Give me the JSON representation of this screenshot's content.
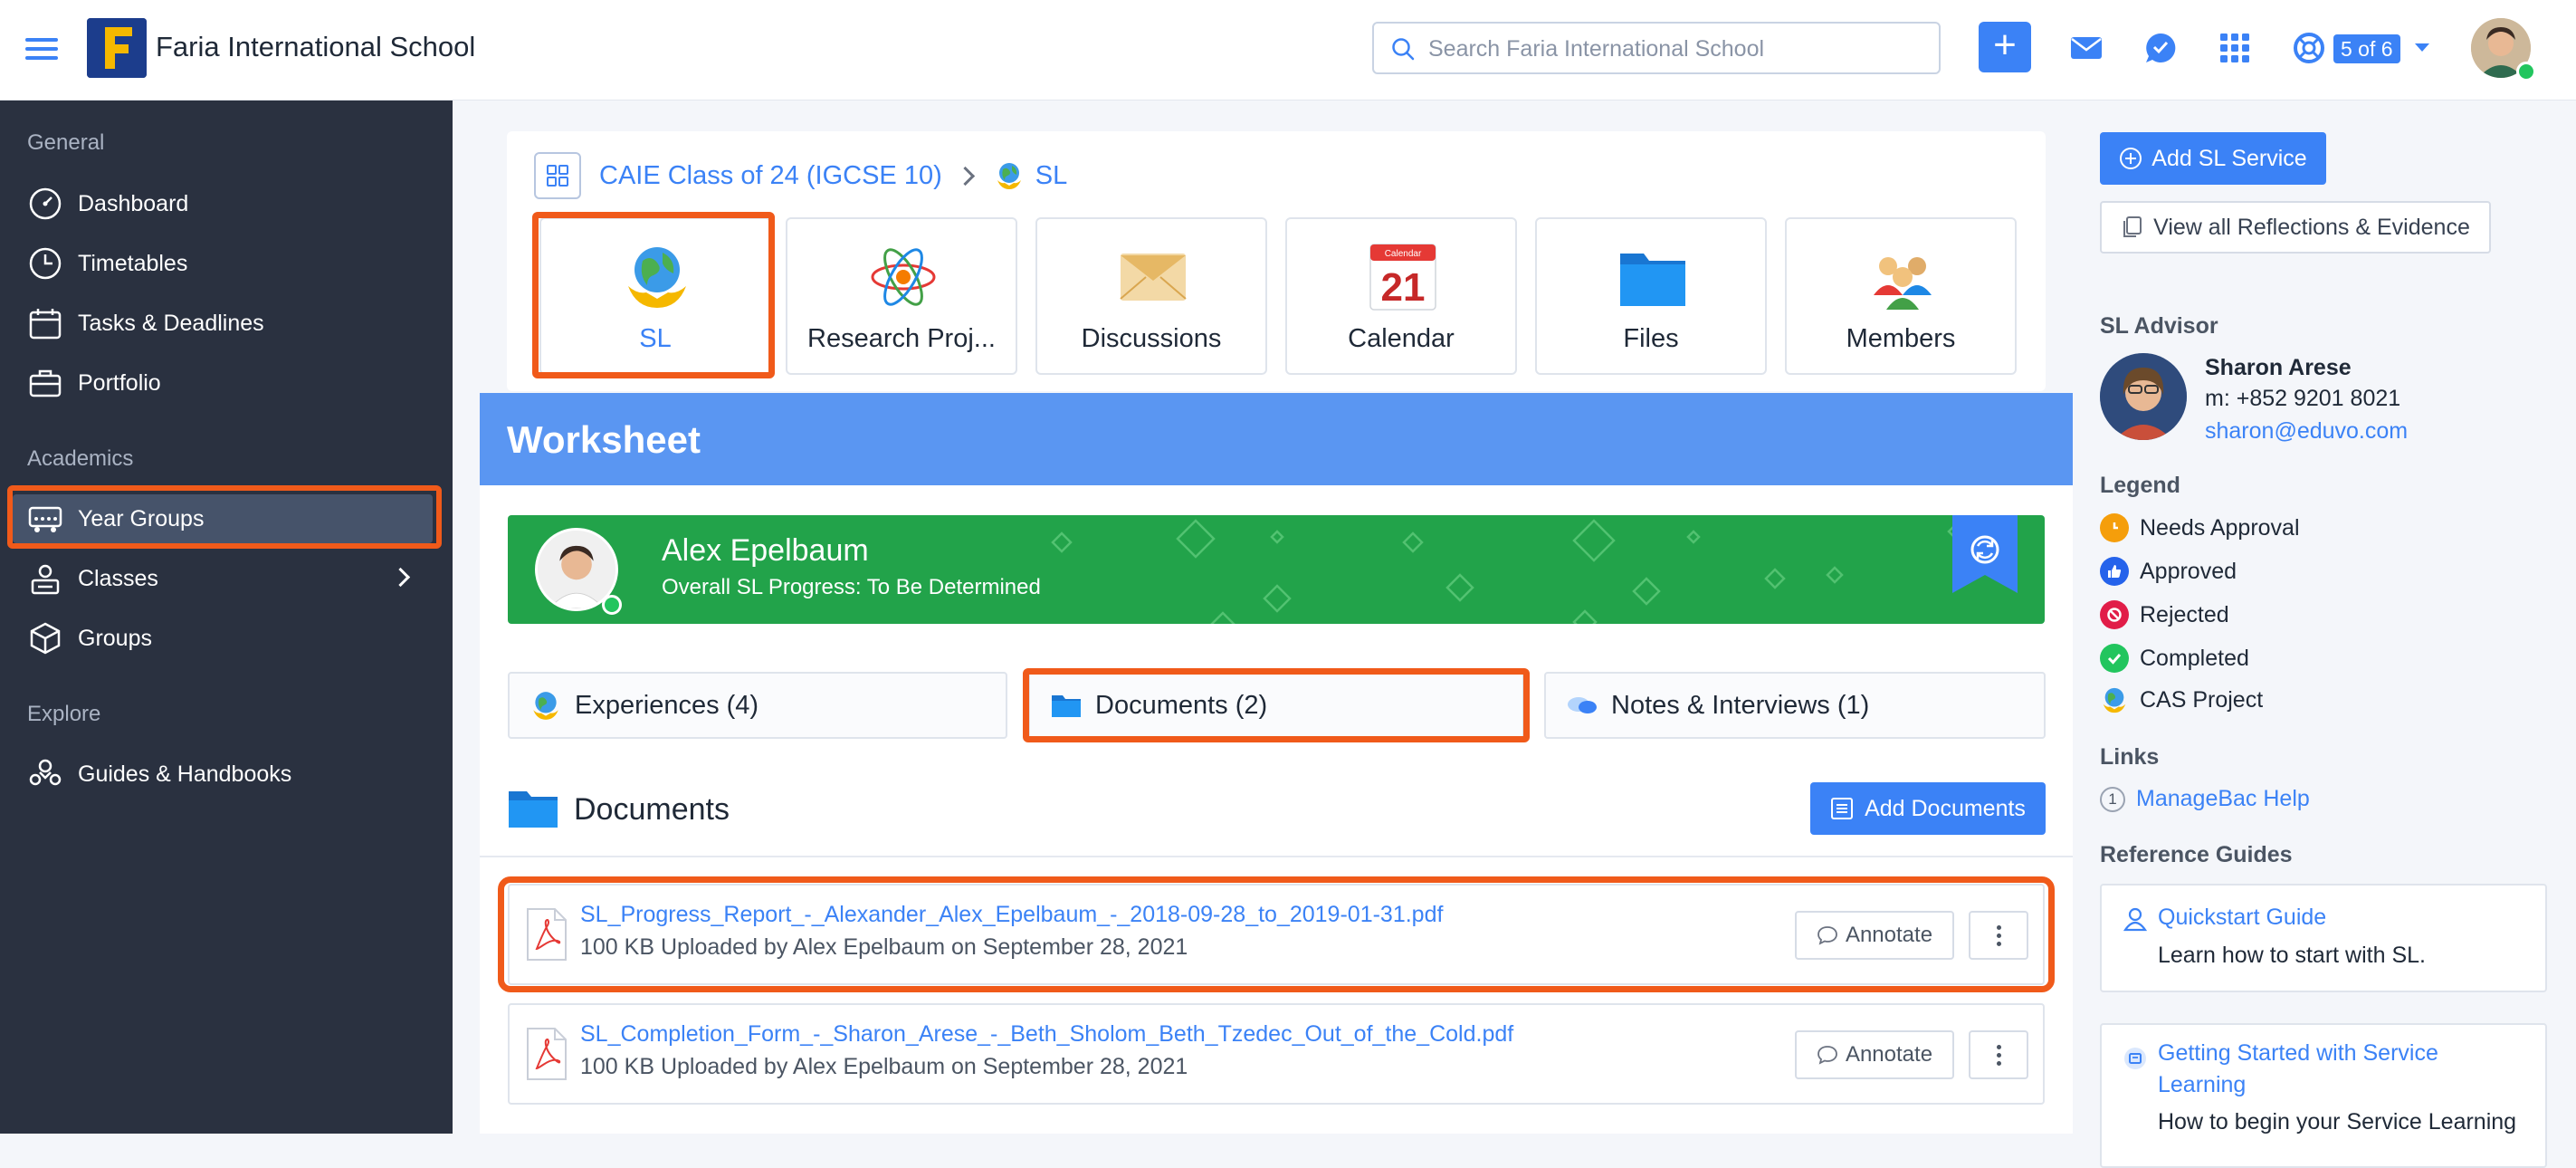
{
  "header": {
    "school_name": "Faria International School",
    "search_placeholder": "Search Faria International School",
    "plus_label": "+",
    "switcher_badge": "5 of 6"
  },
  "sidebar": {
    "sections": [
      {
        "title": "General"
      },
      {
        "title": "Academics"
      },
      {
        "title": "Explore"
      }
    ],
    "items": [
      {
        "label": "Dashboard",
        "icon": "dashboard-icon"
      },
      {
        "label": "Timetables",
        "icon": "clock-icon"
      },
      {
        "label": "Tasks & Deadlines",
        "icon": "calendar-icon"
      },
      {
        "label": "Portfolio",
        "icon": "briefcase-icon"
      },
      {
        "label": "Year Groups",
        "icon": "bus-icon"
      },
      {
        "label": "Classes",
        "icon": "classes-icon"
      },
      {
        "label": "Groups",
        "icon": "cube-icon"
      },
      {
        "label": "Guides & Handbooks",
        "icon": "people-icon"
      }
    ]
  },
  "breadcrumb": {
    "parent": "CAIE Class of 24 (IGCSE 10)",
    "current": "SL"
  },
  "tiles": [
    {
      "label": "SL",
      "icon": "globe-hands-icon"
    },
    {
      "label": "Research Proj...",
      "icon": "atom-icon"
    },
    {
      "label": "Discussions",
      "icon": "envelope-icon"
    },
    {
      "label": "Calendar",
      "icon": "calendar-21-icon",
      "day": "21",
      "month": "Calendar"
    },
    {
      "label": "Files",
      "icon": "folder-icon"
    },
    {
      "label": "Members",
      "icon": "members-icon"
    }
  ],
  "worksheet": {
    "title": "Worksheet",
    "student_name": "Alex Epelbaum",
    "progress_text": "Overall SL Progress: To Be Determined"
  },
  "subtabs": [
    {
      "label": "Experiences (4)",
      "icon": "globe-hands-icon"
    },
    {
      "label": "Documents (2)",
      "icon": "folder-icon"
    },
    {
      "label": "Notes & Interviews (1)",
      "icon": "chat-bubbles-icon"
    }
  ],
  "documents": {
    "title": "Documents",
    "add_label": "Add Documents",
    "annotate_label": "Annotate",
    "rows": [
      {
        "name": "SL_Progress_Report_-_Alexander_Alex_Epelbaum_-_2018-09-28_to_2019-01-31.pdf",
        "meta": "100 KB Uploaded by Alex Epelbaum on September 28, 2021"
      },
      {
        "name": "SL_Completion_Form_-_Sharon_Arese_-_Beth_Sholom_Beth_Tzedec_Out_of_the_Cold.pdf",
        "meta": "100 KB Uploaded by Alex Epelbaum on September 28, 2021"
      }
    ]
  },
  "right_panel": {
    "add_service_label": "Add SL Service",
    "view_all_label": "View all Reflections & Evidence",
    "advisor_heading": "SL Advisor",
    "advisor_name": "Sharon Arese",
    "advisor_phone": "m: +852 9201 8021",
    "advisor_email": "sharon@eduvo.com",
    "legend_heading": "Legend",
    "legend": [
      {
        "label": "Needs Approval",
        "color": "#f59e0b"
      },
      {
        "label": "Approved",
        "color": "#2563eb"
      },
      {
        "label": "Rejected",
        "color": "#e11d48"
      },
      {
        "label": "Completed",
        "color": "#22c55e"
      },
      {
        "label": "CAS Project",
        "icon": "globe-hands-icon"
      }
    ],
    "links_heading": "Links",
    "links": [
      {
        "num": "1",
        "label": "ManageBac Help"
      }
    ],
    "guides_heading": "Reference Guides",
    "guides": [
      {
        "title": "Quickstart Guide",
        "desc": "Learn how to start with SL."
      },
      {
        "title": "Getting Started with Service Learning",
        "desc": "How to begin your Service Learning"
      }
    ]
  },
  "colors": {
    "accent": "#3b82f6",
    "sidebar_bg": "#2a3140",
    "highlight": "#f05a1a",
    "progress_green": "#22a34a",
    "worksheet_bar": "#5a96f2"
  }
}
